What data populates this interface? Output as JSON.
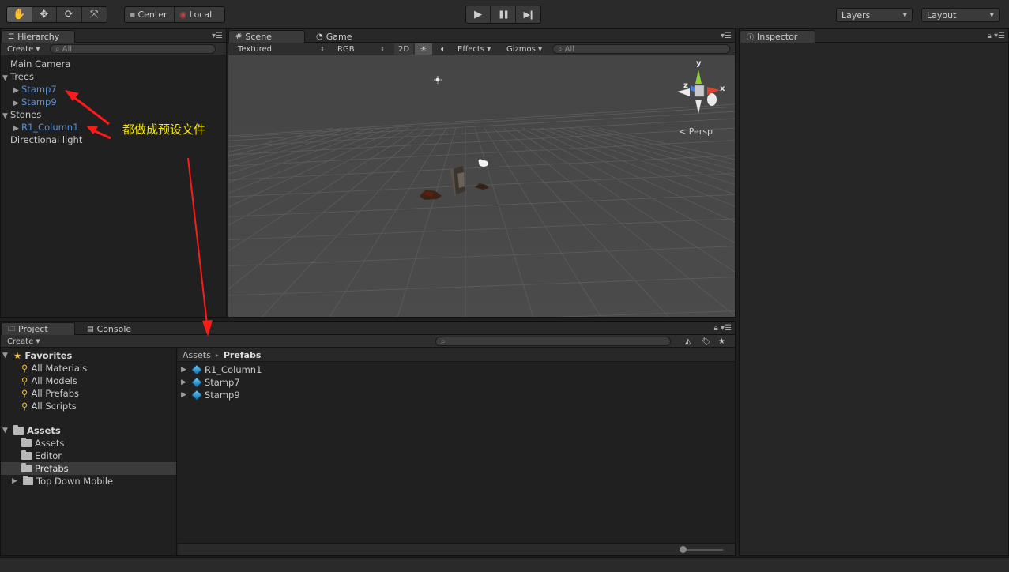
{
  "toolbar": {
    "tools": [
      {
        "name": "hand-tool",
        "glyph": "✋"
      },
      {
        "name": "move-tool",
        "glyph": "✥"
      },
      {
        "name": "rotate-tool",
        "glyph": "⟳"
      },
      {
        "name": "scale-tool",
        "glyph": "⤧"
      }
    ],
    "pivot_center": "Center",
    "pivot_local": "Local",
    "play_glyph": "▶",
    "pause_glyph": "❚❚",
    "step_glyph": "▶❙",
    "layers": "Layers",
    "layout": "Layout"
  },
  "hierarchy": {
    "tab": "Hierarchy",
    "create": "Create",
    "search_placeholder": "All",
    "items": [
      {
        "label": "Main Camera"
      },
      {
        "label": "Trees"
      },
      {
        "label": "Stamp7"
      },
      {
        "label": "Stamp9"
      },
      {
        "label": "Stones"
      },
      {
        "label": "R1_Column1"
      },
      {
        "label": "Directional light"
      }
    ]
  },
  "scene": {
    "tab_scene": "Scene",
    "tab_game": "Game",
    "shading": "Textured",
    "render_mode": "RGB",
    "btn_2d": "2D",
    "effects": "Effects",
    "gizmos": "Gizmos",
    "search_placeholder": "All",
    "gizmo_y": "y",
    "gizmo_x": "x",
    "gizmo_z": "z",
    "persp": "Persp"
  },
  "inspector": {
    "tab": "Inspector"
  },
  "project": {
    "tab_project": "Project",
    "tab_console": "Console",
    "create": "Create",
    "favorites_label": "Favorites",
    "favorites": [
      {
        "label": "All Materials"
      },
      {
        "label": "All Models"
      },
      {
        "label": "All Prefabs"
      },
      {
        "label": "All Scripts"
      }
    ],
    "assets_label": "Assets",
    "folders": [
      {
        "label": "Assets"
      },
      {
        "label": "Editor"
      },
      {
        "label": "Prefabs"
      },
      {
        "label": "Top Down Mobile"
      }
    ],
    "breadcrumb_root": "Assets",
    "breadcrumb_sep": "▸",
    "breadcrumb_current": "Prefabs",
    "prefabs": [
      {
        "label": "R1_Column1"
      },
      {
        "label": "Stamp7"
      },
      {
        "label": "Stamp9"
      }
    ]
  },
  "annotation": {
    "text": "都做成预设文件",
    "color": "#ff1a1a",
    "text_color": "#f5e600"
  }
}
